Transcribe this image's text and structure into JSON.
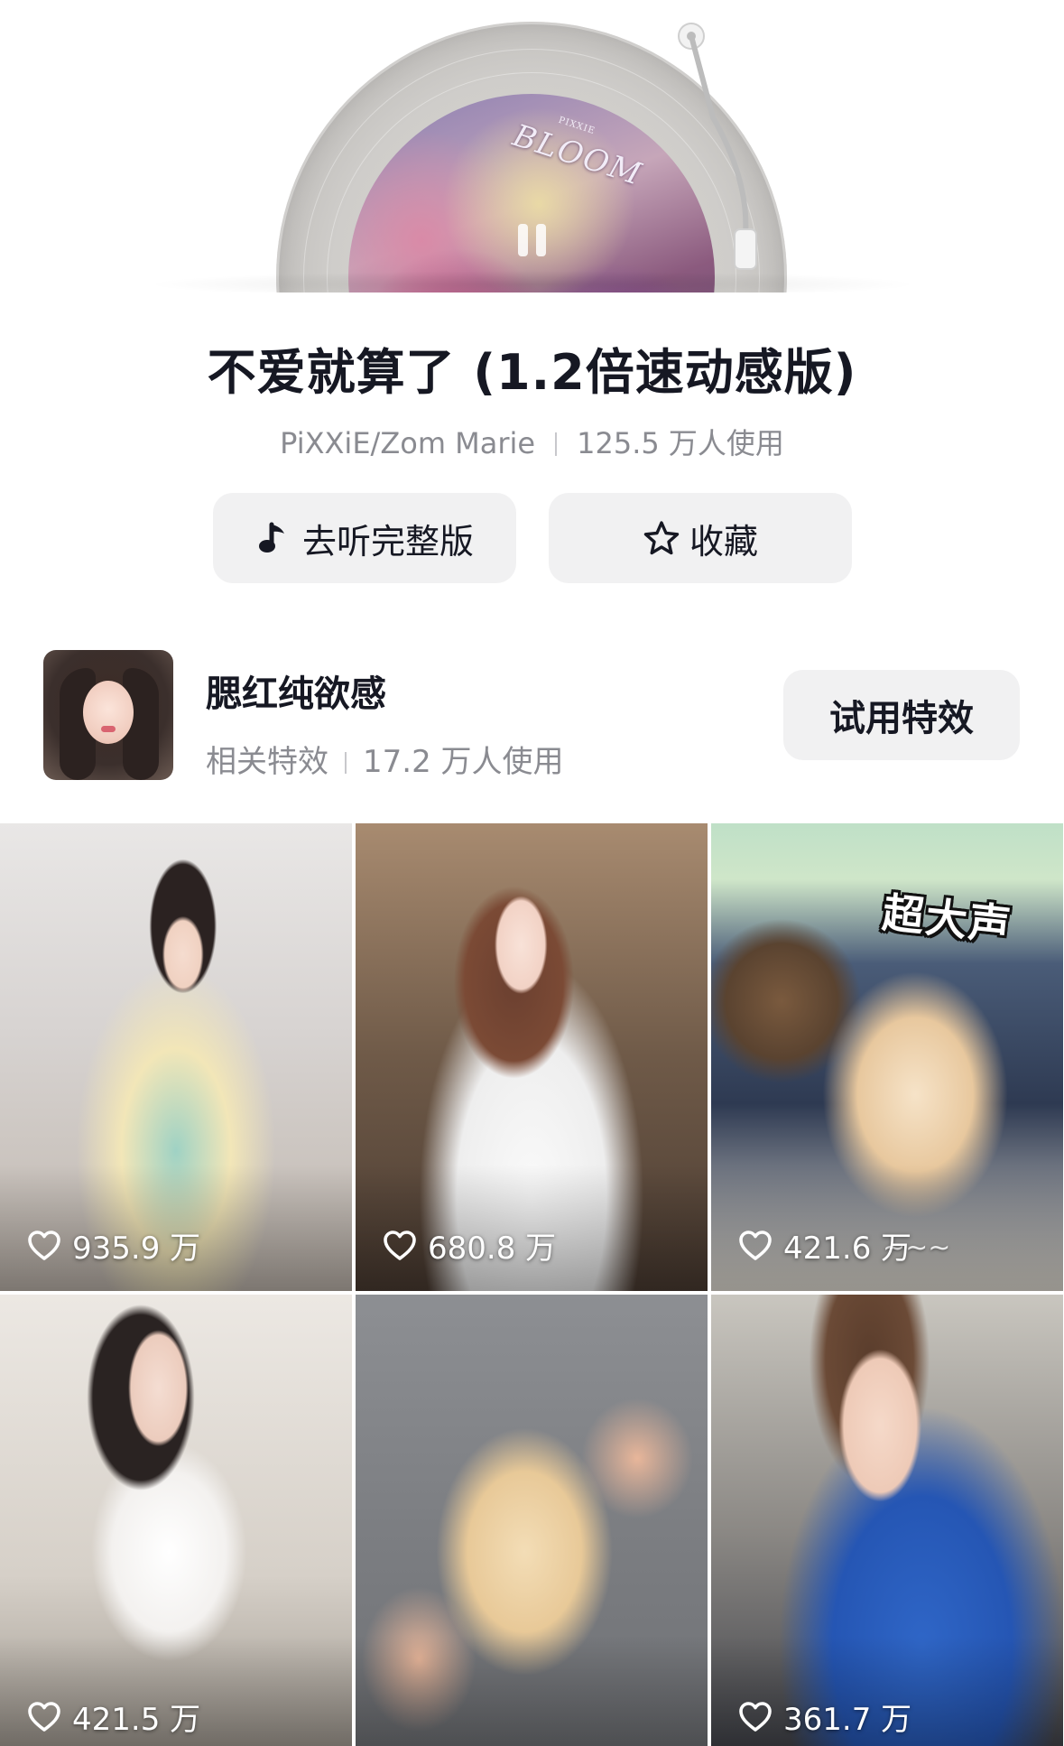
{
  "album": {
    "cover_title": "BLOOM",
    "cover_subtitle": "PIXXIE"
  },
  "song": {
    "title": "不爱就算了 (1.2倍速动感版)",
    "artist": "PiXXiE/Zom Marie",
    "usage": "125.5 万人使用"
  },
  "actions": {
    "listen_label": "去听完整版",
    "favorite_label": "收藏"
  },
  "effect": {
    "name": "腮红纯欲感",
    "category": "相关特效",
    "usage": "17.2 万人使用",
    "try_label": "试用特效"
  },
  "videos": [
    {
      "likes": "935.9 万"
    },
    {
      "likes": "680.8 万"
    },
    {
      "likes": "421.6 万",
      "overlay_text": "超大声",
      "caption": "~~~"
    },
    {
      "likes": "421.5 万"
    },
    {
      "likes": ""
    },
    {
      "likes": "361.7 万"
    }
  ],
  "icons": {
    "play_state": "pause-icon",
    "listen": "music-note-icon",
    "favorite": "star-outline-icon",
    "likes": "heart-outline-icon"
  }
}
